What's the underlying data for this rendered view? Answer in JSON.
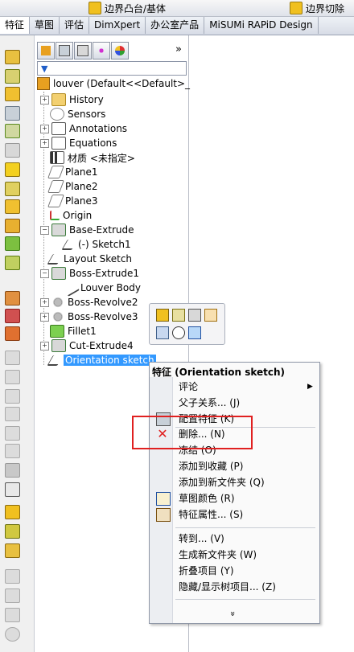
{
  "toolbar": {
    "boundary_boss": "边界凸台/基体",
    "boundary_cut": "边界切除"
  },
  "tabs": [
    "特征",
    "草图",
    "评估",
    "DimXpert",
    "办公室产品",
    "MiSUMi RAPiD Design"
  ],
  "tree": {
    "root": "louver  (Default<<Default>_",
    "nodes": [
      {
        "label": "History",
        "icon": "folder-icon",
        "expand": "+"
      },
      {
        "label": "Sensors",
        "icon": "sensor-icon",
        "expand": ""
      },
      {
        "label": "Annotations",
        "icon": "annotations-icon",
        "expand": "+"
      },
      {
        "label": "Equations",
        "icon": "equations-icon",
        "expand": "+"
      },
      {
        "label": "材质 <未指定>",
        "icon": "material-icon",
        "expand": ""
      },
      {
        "label": "Plane1",
        "icon": "plane-icon",
        "expand": ""
      },
      {
        "label": "Plane2",
        "icon": "plane-icon",
        "expand": ""
      },
      {
        "label": "Plane3",
        "icon": "plane-icon",
        "expand": ""
      },
      {
        "label": "Origin",
        "icon": "origin-icon",
        "expand": ""
      },
      {
        "label": "Base-Extrude",
        "icon": "extrude-icon",
        "expand": "−"
      },
      {
        "label": "(-) Sketch1",
        "icon": "sketch-icon",
        "expand": ""
      },
      {
        "label": "Layout Sketch",
        "icon": "sketch-icon",
        "expand": ""
      },
      {
        "label": "Boss-Extrude1",
        "icon": "extrude-icon",
        "expand": "−"
      },
      {
        "label": "Louver Body",
        "icon": "body-icon",
        "expand": ""
      },
      {
        "label": "Boss-Revolve2",
        "icon": "revolve-icon",
        "expand": "+"
      },
      {
        "label": "Boss-Revolve3",
        "icon": "revolve-icon",
        "expand": "+"
      },
      {
        "label": "Fillet1",
        "icon": "fillet-icon",
        "expand": ""
      },
      {
        "label": "Cut-Extrude4",
        "icon": "cut-icon",
        "expand": "+"
      },
      {
        "label": "Orientation sketch",
        "icon": "sketch-icon",
        "expand": ""
      }
    ]
  },
  "context_menu": {
    "title": "特征 (Orientation sketch)",
    "items": [
      {
        "label": "评论",
        "submenu": true
      },
      {
        "label": "父子关系... (J)"
      },
      {
        "label": "配置特征 (K)"
      },
      {
        "label": "删除... (N)"
      },
      {
        "label": "冻结 (O)"
      },
      {
        "label": "添加到收藏 (P)"
      },
      {
        "label": "添加到新文件夹 (Q)"
      },
      {
        "label": "草图颜色 (R)"
      },
      {
        "label": "特征属性... (S)"
      },
      {
        "label": "转到... (V)"
      },
      {
        "label": "生成新文件夹 (W)"
      },
      {
        "label": "折叠项目 (Y)"
      },
      {
        "label": "隐藏/显示树项目... (Z)"
      }
    ],
    "more": "»"
  },
  "panel_more": "»",
  "colors": {
    "selection": "#3399ff",
    "highlight_box": "#e02020",
    "delete_icon": "#e02020"
  }
}
